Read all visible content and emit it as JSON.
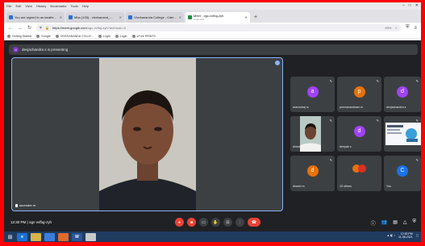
{
  "browser": {
    "menu": [
      "File",
      "Edit",
      "View",
      "History",
      "Bookmarks",
      "Tools",
      "Help"
    ],
    "tabs": [
      {
        "label": "You are signed in as tarathia...",
        "active": false
      },
      {
        "label": "Mba (125) - vivekanand_...",
        "active": false
      },
      {
        "label": "Vivekananda College - Calen...",
        "active": false
      },
      {
        "label": "Meet - ogc-vvfbg-zyh",
        "sub": "4 tab visit",
        "active": true
      }
    ],
    "new_tab": "+",
    "url_host": "https://meet.google.com",
    "url_path": "/ogc-vvfbg-zyh?authuser=0",
    "url_zoom": "90%",
    "bookmarks": [
      "Getting Started",
      "Google",
      "VIVEKANANDA COLLE...",
      "Login",
      "Login",
      "cFree PRINTS"
    ]
  },
  "meet": {
    "presenting_initial": "d",
    "presenting_text": "devjachandra s is presenting",
    "main_speaker": "surender m",
    "tiles": [
      {
        "initial": "a",
        "name": "aravindraj m",
        "color": "#a142f4"
      },
      {
        "initial": "p",
        "name": "premanandham m",
        "color": "#e8710a"
      },
      {
        "initial": "d",
        "name": "devjachandra s",
        "color": "#a142f4"
      },
      {
        "initial": "",
        "name": "dinesh",
        "color": "#5f6368"
      },
      {
        "initial": "d",
        "name": "deepak s",
        "color": "#a142f4"
      },
      {
        "initial": "",
        "name": "",
        "color": "#5f6368"
      },
      {
        "initial": "d",
        "name": "dinesh m",
        "color": "#e8710a"
      },
      {
        "initial": "",
        "name": "15 others",
        "color": "#e8710a"
      },
      {
        "initial": "C",
        "name": "You",
        "color": "#1a73e8"
      }
    ],
    "clock": "12:30 PM",
    "meeting_code": "ogc-vvfbg-zyh"
  },
  "taskbar": {
    "apps": [
      "e",
      "",
      "",
      "W",
      ""
    ],
    "time": "12:30 PM",
    "date": "11-08-2021"
  }
}
